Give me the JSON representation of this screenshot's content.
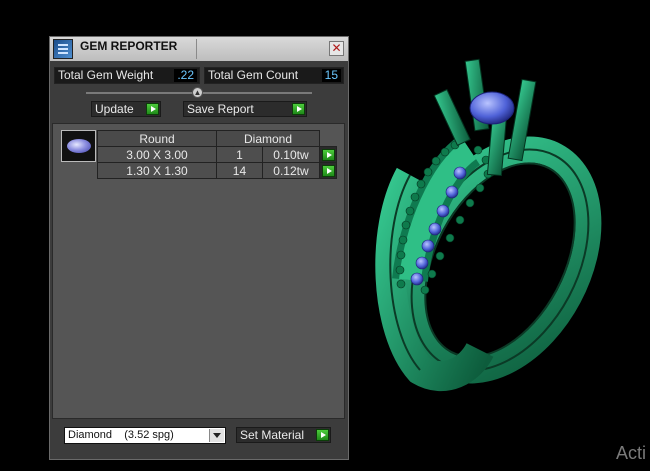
{
  "window": {
    "title": "GEM REPORTER",
    "close_glyph": "✕"
  },
  "stats": {
    "total_weight_label": "Total Gem Weight",
    "total_weight_value": ".22",
    "total_count_label": "Total Gem Count",
    "total_count_value": "15"
  },
  "actions": {
    "update_label": "Update",
    "save_label": "Save Report"
  },
  "table": {
    "headers": [
      "Round",
      "Diamond"
    ],
    "rows": [
      {
        "size": "3.00 X 3.00",
        "count": "1",
        "weight": "0.10tw"
      },
      {
        "size": "1.30 X 1.30",
        "count": "14",
        "weight": "0.12tw"
      }
    ]
  },
  "material": {
    "selected": "Diamond    (3.52 spg)",
    "set_label": "Set Material"
  },
  "overlay": {
    "activate_text": "Acti"
  },
  "icons": {
    "app": "gem-reporter-app-icon",
    "close": "close-icon",
    "arrow": "green-arrow-icon",
    "gem": "round-gem-icon",
    "dropdown": "chevron-down-icon"
  },
  "colors": {
    "ring_green": "#1f9e6e",
    "stone_blue": "#4f62d8",
    "accent_arrow": "#3cba2c",
    "value_text": "#6cc8ff"
  }
}
